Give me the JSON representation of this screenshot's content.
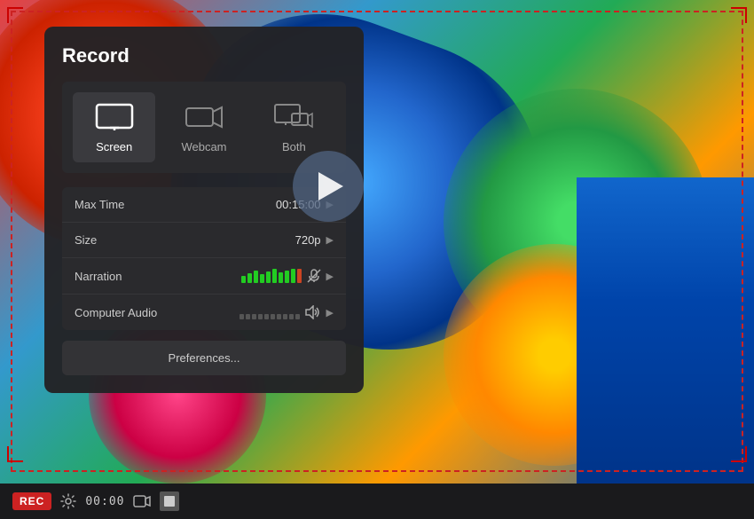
{
  "panel": {
    "title": "Record",
    "modes": [
      {
        "id": "screen",
        "label": "Screen",
        "active": true
      },
      {
        "id": "webcam",
        "label": "Webcam",
        "active": false
      },
      {
        "id": "both",
        "label": "Both",
        "active": false
      }
    ],
    "settings": [
      {
        "id": "max-time",
        "label": "Max Time",
        "value": "00:15:00"
      },
      {
        "id": "size",
        "label": "Size",
        "value": "720p"
      },
      {
        "id": "narration",
        "label": "Narration",
        "value": "",
        "has_meter": true
      },
      {
        "id": "computer-audio",
        "label": "Computer Audio",
        "value": "",
        "has_audio": true
      }
    ],
    "preferences_label": "Preferences..."
  },
  "toolbar": {
    "rec_label": "REC",
    "time": "00:00"
  },
  "colors": {
    "accent_red": "#cc2222",
    "panel_bg": "#232325",
    "settings_bg": "#2a2a2d"
  }
}
